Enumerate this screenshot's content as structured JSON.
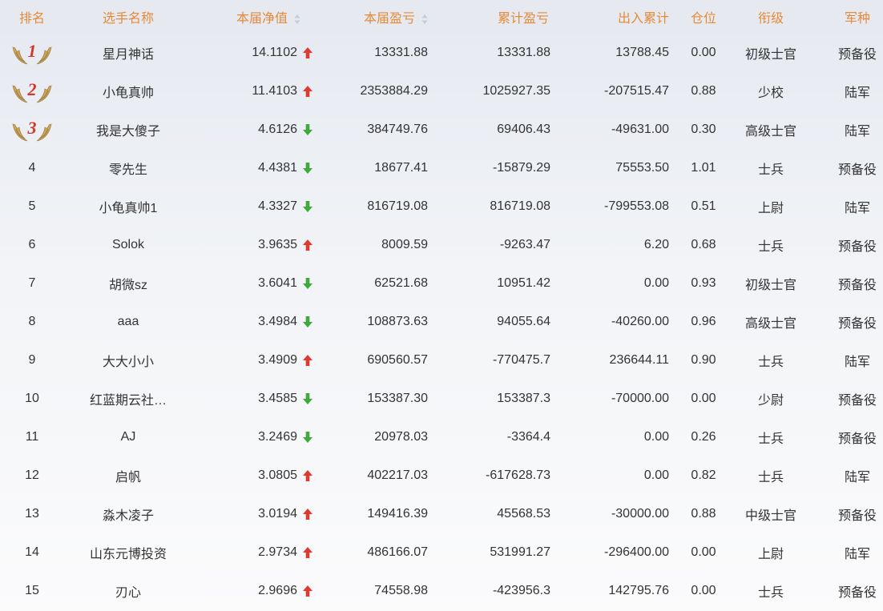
{
  "headers": {
    "rank": "排名",
    "name": "选手名称",
    "nav": "本届净值",
    "profit": "本届盈亏",
    "cum_profit": "累计盈亏",
    "cash_flow": "出入累计",
    "position": "仓位",
    "grade": "衔级",
    "branch": "军种"
  },
  "colors": {
    "header_text": "#e58a3a",
    "up_arrow": "#e0392e",
    "down_arrow": "#3daa3d",
    "medal_number": "#d3372a",
    "medal_wing": "#c9a25a"
  },
  "rows": [
    {
      "rank": "1",
      "name": "星月神话",
      "nav": "14.1102",
      "trend": "up",
      "profit": "13331.88",
      "cum_profit": "13331.88",
      "cash_flow": "13788.45",
      "position": "0.00",
      "grade": "初级士官",
      "branch": "预备役"
    },
    {
      "rank": "2",
      "name": "小龟真帅",
      "nav": "11.4103",
      "trend": "up",
      "profit": "2353884.29",
      "cum_profit": "1025927.35",
      "cash_flow": "-207515.47",
      "position": "0.88",
      "grade": "少校",
      "branch": "陆军"
    },
    {
      "rank": "3",
      "name": "我是大傻子",
      "nav": "4.6126",
      "trend": "down",
      "profit": "384749.76",
      "cum_profit": "69406.43",
      "cash_flow": "-49631.00",
      "position": "0.30",
      "grade": "高级士官",
      "branch": "陆军"
    },
    {
      "rank": "4",
      "name": "零先生",
      "nav": "4.4381",
      "trend": "down",
      "profit": "18677.41",
      "cum_profit": "-15879.29",
      "cash_flow": "75553.50",
      "position": "1.01",
      "grade": "士兵",
      "branch": "预备役"
    },
    {
      "rank": "5",
      "name": "小龟真帅1",
      "nav": "4.3327",
      "trend": "down",
      "profit": "816719.08",
      "cum_profit": "816719.08",
      "cash_flow": "-799553.08",
      "position": "0.51",
      "grade": "上尉",
      "branch": "陆军"
    },
    {
      "rank": "6",
      "name": "Solok",
      "nav": "3.9635",
      "trend": "up",
      "profit": "8009.59",
      "cum_profit": "-9263.47",
      "cash_flow": "6.20",
      "position": "0.68",
      "grade": "士兵",
      "branch": "预备役"
    },
    {
      "rank": "7",
      "name": "胡微sz",
      "nav": "3.6041",
      "trend": "down",
      "profit": "62521.68",
      "cum_profit": "10951.42",
      "cash_flow": "0.00",
      "position": "0.93",
      "grade": "初级士官",
      "branch": "预备役"
    },
    {
      "rank": "8",
      "name": "aaa",
      "nav": "3.4984",
      "trend": "down",
      "profit": "108873.63",
      "cum_profit": "94055.64",
      "cash_flow": "-40260.00",
      "position": "0.96",
      "grade": "高级士官",
      "branch": "预备役"
    },
    {
      "rank": "9",
      "name": "大大小小",
      "nav": "3.4909",
      "trend": "up",
      "profit": "690560.57",
      "cum_profit": "-770475.7",
      "cash_flow": "236644.11",
      "position": "0.90",
      "grade": "士兵",
      "branch": "陆军"
    },
    {
      "rank": "10",
      "name": "红蓝期云社…",
      "nav": "3.4585",
      "trend": "down",
      "profit": "153387.30",
      "cum_profit": "153387.3",
      "cash_flow": "-70000.00",
      "position": "0.00",
      "grade": "少尉",
      "branch": "预备役"
    },
    {
      "rank": "11",
      "name": "AJ",
      "nav": "3.2469",
      "trend": "down",
      "profit": "20978.03",
      "cum_profit": "-3364.4",
      "cash_flow": "0.00",
      "position": "0.26",
      "grade": "士兵",
      "branch": "预备役"
    },
    {
      "rank": "12",
      "name": "启帆",
      "nav": "3.0805",
      "trend": "up",
      "profit": "402217.03",
      "cum_profit": "-617628.73",
      "cash_flow": "0.00",
      "position": "0.82",
      "grade": "士兵",
      "branch": "陆军"
    },
    {
      "rank": "13",
      "name": "淼木凌子",
      "nav": "3.0194",
      "trend": "up",
      "profit": "149416.39",
      "cum_profit": "45568.53",
      "cash_flow": "-30000.00",
      "position": "0.88",
      "grade": "中级士官",
      "branch": "预备役"
    },
    {
      "rank": "14",
      "name": "山东元博投资",
      "nav": "2.9734",
      "trend": "up",
      "profit": "486166.07",
      "cum_profit": "531991.27",
      "cash_flow": "-296400.00",
      "position": "0.00",
      "grade": "上尉",
      "branch": "陆军"
    },
    {
      "rank": "15",
      "name": "刃心",
      "nav": "2.9696",
      "trend": "up",
      "profit": "74558.98",
      "cum_profit": "-423956.3",
      "cash_flow": "142795.76",
      "position": "0.00",
      "grade": "士兵",
      "branch": "预备役"
    }
  ]
}
